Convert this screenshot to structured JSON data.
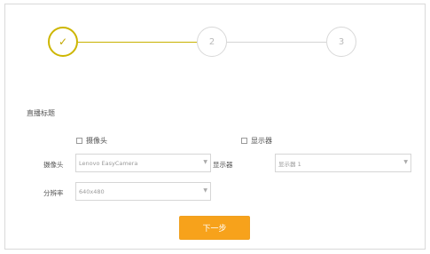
{
  "stepper": {
    "steps": [
      {
        "label": "✓",
        "state": "done"
      },
      {
        "label": "2",
        "state": "pending"
      },
      {
        "label": "3",
        "state": "pending"
      }
    ],
    "accent_color": "#cdb600"
  },
  "section": {
    "title": "直播标题"
  },
  "camera": {
    "checkbox_label": "摄像头",
    "field_label": "摄像头",
    "selected": "Lenovo EasyCamera",
    "resolution_label": "分辨率",
    "resolution_value": "640x480"
  },
  "display": {
    "checkbox_label": "显示器",
    "field_label": "显示器",
    "selected": "显示器 1"
  },
  "actions": {
    "next_label": "下一步",
    "next_color": "#f7a21b"
  }
}
